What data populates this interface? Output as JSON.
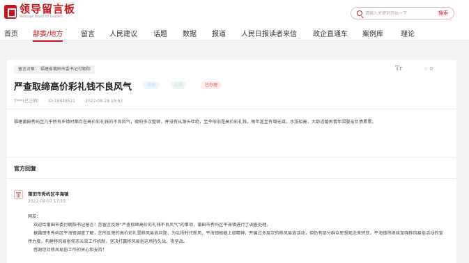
{
  "brand": {
    "name_cn": "领导留言板",
    "name_en": "Message Board for Leaders",
    "accent_color": "#c8161d"
  },
  "search": {
    "placeholder": "请输入关键词开始一下",
    "button_label": "搜索",
    "icon": "search-icon"
  },
  "nav": {
    "items": [
      {
        "label": "首页"
      },
      {
        "label": "部委/地方",
        "active": true
      },
      {
        "label": "留言"
      },
      {
        "label": "人民建议"
      },
      {
        "label": "话题"
      },
      {
        "label": "数据"
      },
      {
        "label": "报道"
      },
      {
        "label": "人民日报读者来信"
      },
      {
        "label": "政企直通车"
      },
      {
        "label": "案例库"
      },
      {
        "label": "理论"
      }
    ]
  },
  "message": {
    "breadcrumb": "留言对象：  福建省莆田市委书记付朝阳",
    "font_size_label": "Tr",
    "like_label": "☆ 0",
    "title": "严查取缔高价彩礼钱不良风气",
    "tags": [
      "其他",
      "三农",
      "已办理"
    ],
    "author": "T***(已注销)",
    "id": "ID:15848521",
    "datetime": "2022-08-28 19:02",
    "body": "福建莆田秀屿区几乎所有乡镇村都存在高价彩礼钱的不良风气，政府多次整顿，并没有从源头杜绝，至今依旧是高价彩礼钱，每年甚至有增无减，水涨船高，大龄适婚男青年因娶亲负债累累。"
  },
  "reply": {
    "section_title": "官方回复",
    "org_name": "莆田市秀屿区平海镇",
    "org_datetime": "2022-09-07 17:55",
    "lines": [
      "网友：",
      "欢迎给莆田市委付朝阳书记留言！您留言反映“严查取缔高价彩礼钱不良风气”的事项，莆田市秀屿区平海镇进行了调查处理。",
      "据莆田市秀屿区平海镇调查了解，您所反映的高价彩礼是移风易俗问题，为弘扬时代新风，平海镇根据上级精神，开展过多层次的移风易俗活动，但仍有部分群众思想观念未转变。平海镇将继续加强移风易俗活动的宣传力度，构建移风易俗常态长效工作机制，坚决打赢移风易俗这场持久战、攻坚战。",
      "感谢您对移风易俗工作的关心和支持！"
    ]
  }
}
